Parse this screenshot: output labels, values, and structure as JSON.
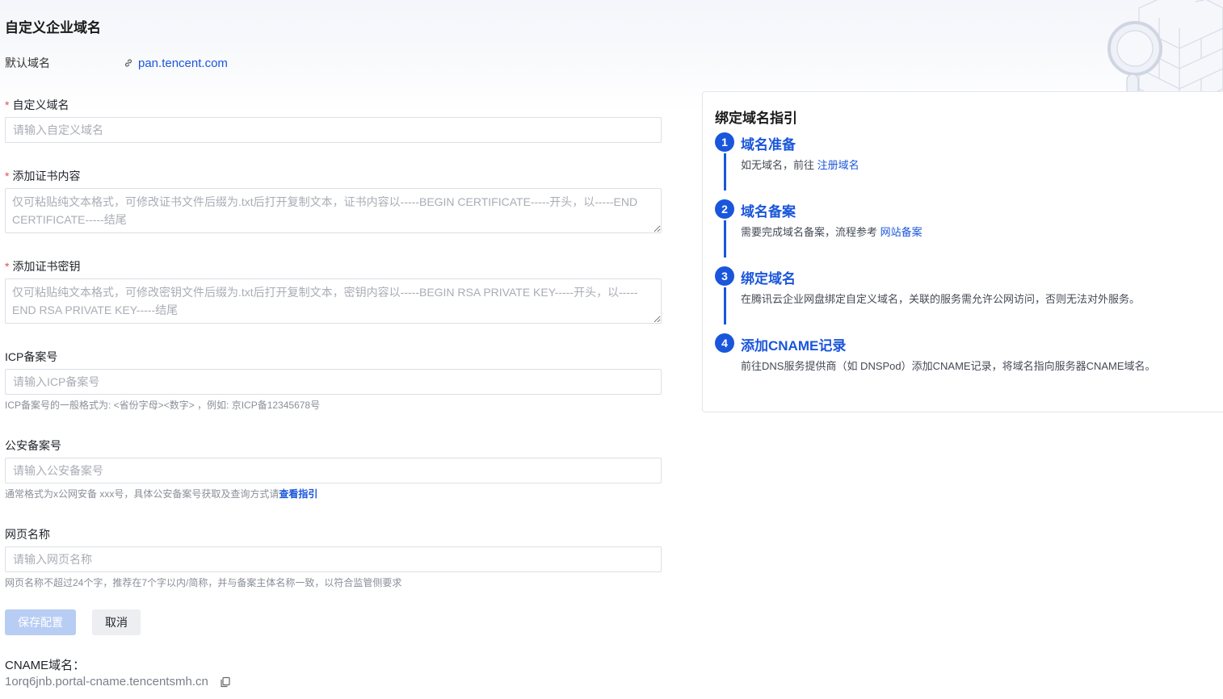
{
  "page": {
    "title": "自定义企业域名"
  },
  "default_domain": {
    "label": "默认域名",
    "link_icon": "link-icon",
    "value": "pan.tencent.com"
  },
  "form": {
    "custom_domain": {
      "required": "*",
      "label": "自定义域名",
      "placeholder": "请输入自定义域名"
    },
    "certificate": {
      "required": "*",
      "label": "添加证书内容",
      "placeholder": "仅可粘贴纯文本格式，可修改证书文件后缀为.txt后打开复制文本，证书内容以-----BEGIN CERTIFICATE-----开头，以-----END CERTIFICATE-----结尾"
    },
    "private_key": {
      "required": "*",
      "label": "添加证书密钥",
      "placeholder": "仅可粘贴纯文本格式，可修改密钥文件后缀为.txt后打开复制文本，密钥内容以-----BEGIN RSA PRIVATE KEY-----开头，以-----END RSA PRIVATE KEY-----结尾"
    },
    "icp": {
      "label": "ICP备案号",
      "placeholder": "请输入ICP备案号",
      "hint": "ICP备案号的一般格式为: <省份字母><数字> ，例如: 京ICP备12345678号"
    },
    "police": {
      "label": "公安备案号",
      "placeholder": "请输入公安备案号",
      "hint": "通常格式为x公网安备 xxx号，具体公安备案号获取及查询方式请",
      "hint_link": "查看指引"
    },
    "page_name": {
      "label": "网页名称",
      "placeholder": "请输入网页名称",
      "hint": "网页名称不超过24个字，推荐在7个字以内/简称，并与备案主体名称一致，以符合监管侧要求"
    }
  },
  "actions": {
    "save_label": "保存配置",
    "cancel_label": "取消"
  },
  "cname": {
    "label": "CNAME域名：",
    "value": "1orq6jnb.portal-cname.tencentsmh.cn",
    "copy_icon": "copy-icon"
  },
  "guide": {
    "title": "绑定域名指引",
    "steps": [
      {
        "num": "1",
        "title": "域名准备",
        "desc": "如无域名，前往 ",
        "link": "注册域名"
      },
      {
        "num": "2",
        "title": "域名备案",
        "desc": "需要完成域名备案，流程参考 ",
        "link": "网站备案"
      },
      {
        "num": "3",
        "title": "绑定域名",
        "desc": "在腾讯云企业网盘绑定自定义域名，关联的服务需允许公网访问，否则无法对外服务。"
      },
      {
        "num": "4",
        "title": "添加CNAME记录",
        "desc": "前往DNS服务提供商（如 DNSPod）添加CNAME记录，将域名指向服务器CNAME域名。"
      }
    ]
  },
  "colors": {
    "accent": "#1a56db",
    "required": "#e34d59",
    "save_disabled": "#b8cdf4"
  }
}
